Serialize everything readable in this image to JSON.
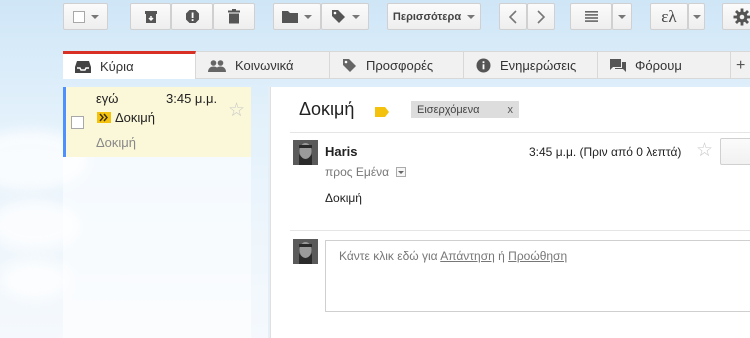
{
  "toolbar": {
    "more_label": "Περισσότερα",
    "language_label": "ελ",
    "buttons": [
      "select-checkbox",
      "archive-icon",
      "report-spam-icon",
      "delete-icon",
      "move-to-folder-icon",
      "labels-icon",
      "prev-icon",
      "next-icon",
      "density-icon",
      "settings-icon"
    ]
  },
  "tabs": [
    {
      "label": "Κύρια",
      "icon": "inbox-icon",
      "active": true
    },
    {
      "label": "Κοινωνικά",
      "icon": "people-icon",
      "active": false
    },
    {
      "label": "Προσφορές",
      "icon": "tag-icon",
      "active": false
    },
    {
      "label": "Ενημερώσεις",
      "icon": "info-icon",
      "active": false
    },
    {
      "label": "Φόρουμ",
      "icon": "forum-icon",
      "active": false
    }
  ],
  "add_tab_label": "+",
  "message_list": {
    "items": [
      {
        "sender": "εγώ",
        "time": "3:45 μ.μ.",
        "subject": "Δοκιμή",
        "snippet": "Δοκιμή",
        "starred": false
      }
    ]
  },
  "reading_pane": {
    "subject": "Δοκιμή",
    "label_chip": "Εισερχόμενα",
    "label_remove": "x",
    "sender_name": "Haris",
    "time": "3:45 μ.μ. (Πριν από 0 λεπτά)",
    "to_line": "προς Εμένα",
    "body": "Δοκιμή",
    "reply_prompt_prefix": "Κάντε κλικ εδώ για",
    "reply_link": "Απάντηση",
    "reply_or": "ή",
    "forward_link": "Προώθηση"
  },
  "colors": {
    "accent_red": "#d93025",
    "selected_row": "#fbf8d9",
    "unread_bar": "#4d90fe",
    "label_chip_bg": "#dddddd",
    "important_marker": "#f4c20d"
  }
}
